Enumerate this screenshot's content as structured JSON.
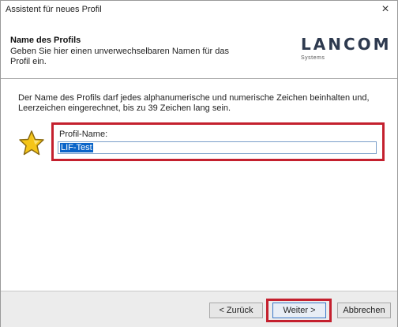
{
  "window": {
    "title": "Assistent für neues Profil",
    "close_label": "×"
  },
  "header": {
    "title": "Name des Profils",
    "description": "Geben Sie hier einen unverwechselbaren Namen für das Profil ein.",
    "logo_text": "LANCOM",
    "logo_sub": "Systems"
  },
  "content": {
    "instructions": "Der Name des Profils darf jedes alphanumerische und numerische Zeichen beinhalten und, Leerzeichen eingerechnet, bis zu 39 Zeichen lang sein.",
    "field_label": "Profil-Name:",
    "field_value": "LIF-Test",
    "icon": "star-icon"
  },
  "footer": {
    "back_label": "< Zurück",
    "next_label": "Weiter >",
    "cancel_label": "Abbrechen"
  },
  "colors": {
    "highlight": "#c4202e",
    "selection": "#0a64c8",
    "star": "#f5c518"
  }
}
